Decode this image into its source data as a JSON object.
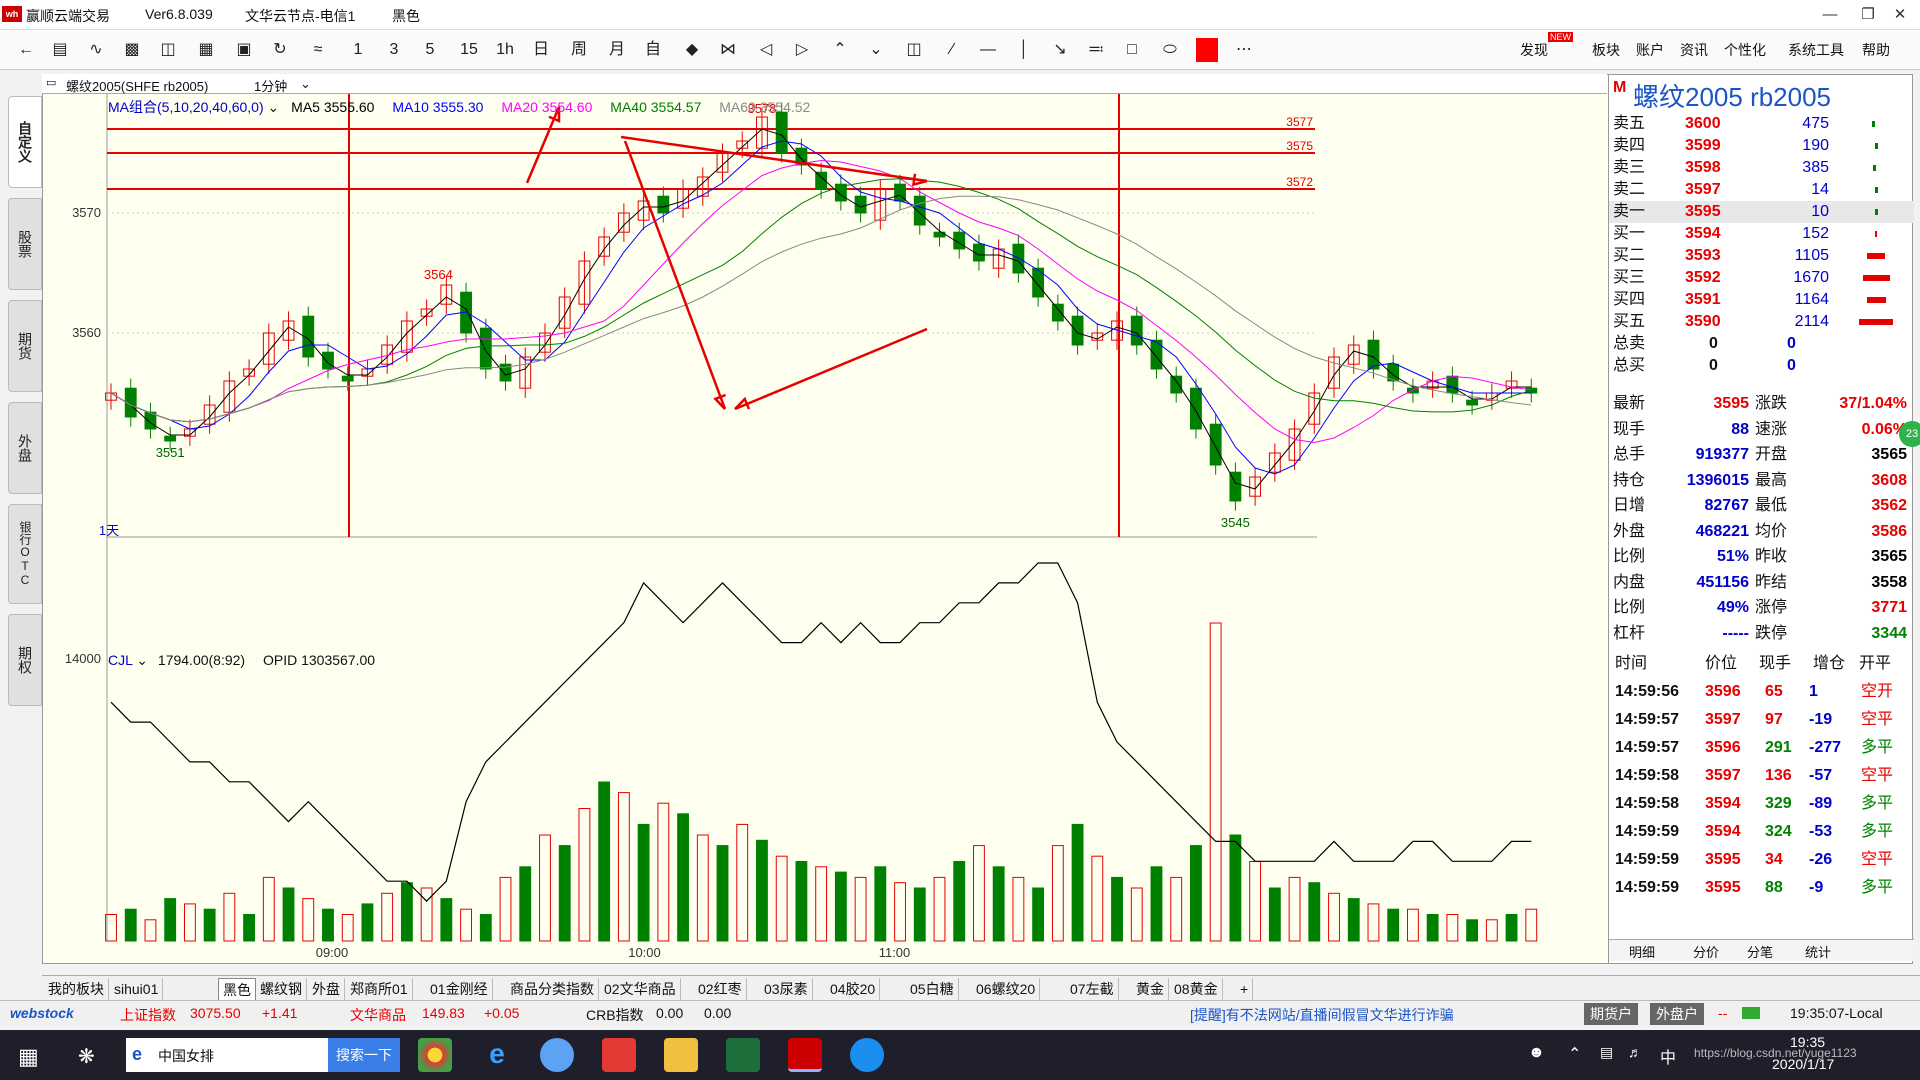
{
  "app": {
    "title": "赢顺云端交易",
    "version": "Ver6.8.039",
    "node": "文华云节点-电信1",
    "theme": "黑色"
  },
  "toolbar": {
    "periods": [
      "1",
      "3",
      "5",
      "15",
      "1h",
      "日",
      "周",
      "月",
      "自"
    ],
    "right": [
      "发现",
      "板块",
      "账户",
      "资讯",
      "个性化",
      "系统工具",
      "帮助"
    ],
    "new_badge": "NEW"
  },
  "left_tabs": [
    "自定义",
    "股票",
    "期货",
    "外盘",
    "银行OTC",
    "期权"
  ],
  "chart_header": {
    "symbol": "螺纹2005(SHFE rb2005)",
    "period": "1分钟"
  },
  "ma_legend": {
    "group": "MA组合(5,10,20,40,60,0)",
    "ma5": "MA5 3555.60",
    "ma10": "MA10 3555.30",
    "ma20": "MA20 3554.60",
    "ma40": "MA40 3554.57",
    "ma60": "MA60 3554.52"
  },
  "colors": {
    "up": "#e60000",
    "down": "#008000",
    "ma5": "#000000",
    "ma10": "#0000ff",
    "ma20": "#ff00ff",
    "ma40": "#008000",
    "ma60": "#888888",
    "annot": "#e60000"
  },
  "chart_data": {
    "type": "candlestick",
    "ylim": [
      3543,
      3580
    ],
    "y_ticks": [
      3570,
      3560
    ],
    "x_ticks": [
      "09:00",
      "10:00",
      "11:00"
    ],
    "hlines": [
      3577,
      3575,
      3572
    ],
    "annotations": [
      "3578",
      "3564",
      "3551",
      "3545",
      "1天"
    ],
    "close": [
      3555,
      3553,
      3552,
      3551,
      3552,
      3554,
      3556,
      3557,
      3560,
      3561,
      3558,
      3557,
      3556,
      3557,
      3559,
      3561,
      3562,
      3564,
      3560,
      3557,
      3556,
      3558,
      3560,
      3563,
      3566,
      3568,
      3570,
      3571,
      3570,
      3572,
      3573,
      3575,
      3576,
      3578,
      3575,
      3574,
      3572,
      3571,
      3570,
      3572,
      3571,
      3569,
      3568,
      3567,
      3566,
      3567,
      3565,
      3563,
      3561,
      3559,
      3560,
      3561,
      3559,
      3557,
      3555,
      3552,
      3549,
      3546,
      3548,
      3550,
      3552,
      3555,
      3558,
      3559,
      3557,
      3556,
      3555,
      3556,
      3555,
      3554,
      3555,
      3556,
      3555
    ],
    "volume": [
      5,
      6,
      4,
      8,
      7,
      6,
      9,
      5,
      12,
      10,
      8,
      6,
      5,
      7,
      9,
      11,
      10,
      8,
      6,
      5,
      12,
      14,
      20,
      18,
      25,
      30,
      28,
      22,
      26,
      24,
      20,
      18,
      22,
      19,
      16,
      15,
      14,
      13,
      12,
      14,
      11,
      10,
      12,
      15,
      18,
      14,
      12,
      10,
      18,
      22,
      16,
      12,
      10,
      14,
      12,
      18,
      60,
      20,
      15,
      10,
      12,
      11,
      9,
      8,
      7,
      6,
      6,
      5,
      5,
      4,
      4,
      5,
      6
    ],
    "volume_ytick": 14000,
    "oi_label": "CJL",
    "oi_value": "1794.00(8:92)",
    "opid": "OPID 1303567.00",
    "oi_line": [
      11,
      10,
      10,
      9,
      8,
      8,
      7,
      7,
      6,
      5,
      6,
      5,
      4,
      3,
      2,
      2,
      1,
      2,
      6,
      8,
      9,
      10,
      11,
      12,
      13,
      14,
      15,
      17,
      16,
      15,
      16,
      17,
      16,
      15,
      14,
      14,
      15,
      14,
      15,
      14,
      14,
      15,
      15,
      16,
      16,
      17,
      17,
      18,
      18,
      16,
      11,
      9,
      8,
      7,
      6,
      5,
      4,
      4,
      3,
      3,
      3,
      3,
      4,
      3,
      3,
      3,
      4,
      4,
      3,
      3,
      3,
      4,
      4
    ]
  },
  "quote": {
    "title": "螺纹2005 rb2005",
    "mark": "M",
    "asks": [
      {
        "l": "卖五",
        "p": "3600",
        "v": "475"
      },
      {
        "l": "卖四",
        "p": "3599",
        "v": "190"
      },
      {
        "l": "卖三",
        "p": "3598",
        "v": "385"
      },
      {
        "l": "卖二",
        "p": "3597",
        "v": "14"
      },
      {
        "l": "卖一",
        "p": "3595",
        "v": "10"
      }
    ],
    "bids": [
      {
        "l": "买一",
        "p": "3594",
        "v": "152"
      },
      {
        "l": "买二",
        "p": "3593",
        "v": "1105"
      },
      {
        "l": "买三",
        "p": "3592",
        "v": "1670"
      },
      {
        "l": "买四",
        "p": "3591",
        "v": "1164"
      },
      {
        "l": "买五",
        "p": "3590",
        "v": "2114"
      }
    ],
    "totals": [
      {
        "l": "总卖",
        "v": "0",
        "v2": "0"
      },
      {
        "l": "总买",
        "v": "0",
        "v2": "0"
      }
    ],
    "stats": [
      {
        "a": "最新",
        "av": "3595",
        "b": "涨跌",
        "bv": "37/1.04%"
      },
      {
        "a": "现手",
        "av": "88",
        "b": "速涨",
        "bv": "0.06%"
      },
      {
        "a": "总手",
        "av": "919377",
        "b": "开盘",
        "bv": "3565"
      },
      {
        "a": "持仓",
        "av": "1396015",
        "b": "最高",
        "bv": "3608"
      },
      {
        "a": "日增",
        "av": "82767",
        "b": "最低",
        "bv": "3562"
      },
      {
        "a": "外盘",
        "av": "468221",
        "b": "均价",
        "bv": "3586"
      },
      {
        "a": "比例",
        "av": "51%",
        "b": "昨收",
        "bv": "3565"
      },
      {
        "a": "内盘",
        "av": "451156",
        "b": "昨结",
        "bv": "3558"
      },
      {
        "a": "比例",
        "av": "49%",
        "b": "涨停",
        "bv": "3771"
      },
      {
        "a": "杠杆",
        "av": "-----",
        "b": "跌停",
        "bv": "3344"
      }
    ],
    "ticks_header": [
      "时间",
      "价位",
      "现手",
      "增仓",
      "开平"
    ],
    "ticks": [
      [
        "14:59:56",
        "3596",
        "65",
        "1",
        "空开"
      ],
      [
        "14:59:57",
        "3597",
        "97",
        "-19",
        "空平"
      ],
      [
        "14:59:57",
        "3596",
        "291",
        "-277",
        "多平"
      ],
      [
        "14:59:58",
        "3597",
        "136",
        "-57",
        "空平"
      ],
      [
        "14:59:58",
        "3594",
        "329",
        "-89",
        "多平"
      ],
      [
        "14:59:59",
        "3594",
        "324",
        "-53",
        "多平"
      ],
      [
        "14:59:59",
        "3595",
        "34",
        "-26",
        "空平"
      ],
      [
        "14:59:59",
        "3595",
        "88",
        "-9",
        "多平"
      ]
    ],
    "bottom_tabs": [
      "明细",
      "分价",
      "分笔",
      "统计"
    ],
    "badge": "23"
  },
  "bottom_tabs": [
    "我的板块",
    "sihui01",
    "黑色",
    "螺纹钢",
    "外盘",
    "郑商所01",
    "01金刚经",
    "商品分类指数",
    "02文华商品",
    "02红枣",
    "03尿素",
    "04胶20",
    "05白糖",
    "06螺纹20",
    "07左截",
    "黄金",
    "08黄金",
    "+"
  ],
  "status": {
    "idx1_name": "上证指数",
    "idx1_val": "3075.50",
    "idx1_chg": "+1.41",
    "idx2_name": "文华商品",
    "idx2_val": "149.83",
    "idx2_chg": "+0.05",
    "idx3_name": "CRB指数",
    "idx3_val": "0.00",
    "idx3_chg": "0.00",
    "notice": "[提醒]有不法网站/直播间假冒文华进行诈骗",
    "btn1": "期货户",
    "btn2": "外盘户",
    "time": "19:35:07-Local",
    "brand": "webstock"
  },
  "taskbar": {
    "search_text": "中国女排",
    "search_btn": "搜索一下",
    "time": "19:35",
    "date": "2020/1/17",
    "ime": "中",
    "watermark": "https://blog.csdn.net/yuge1123"
  }
}
